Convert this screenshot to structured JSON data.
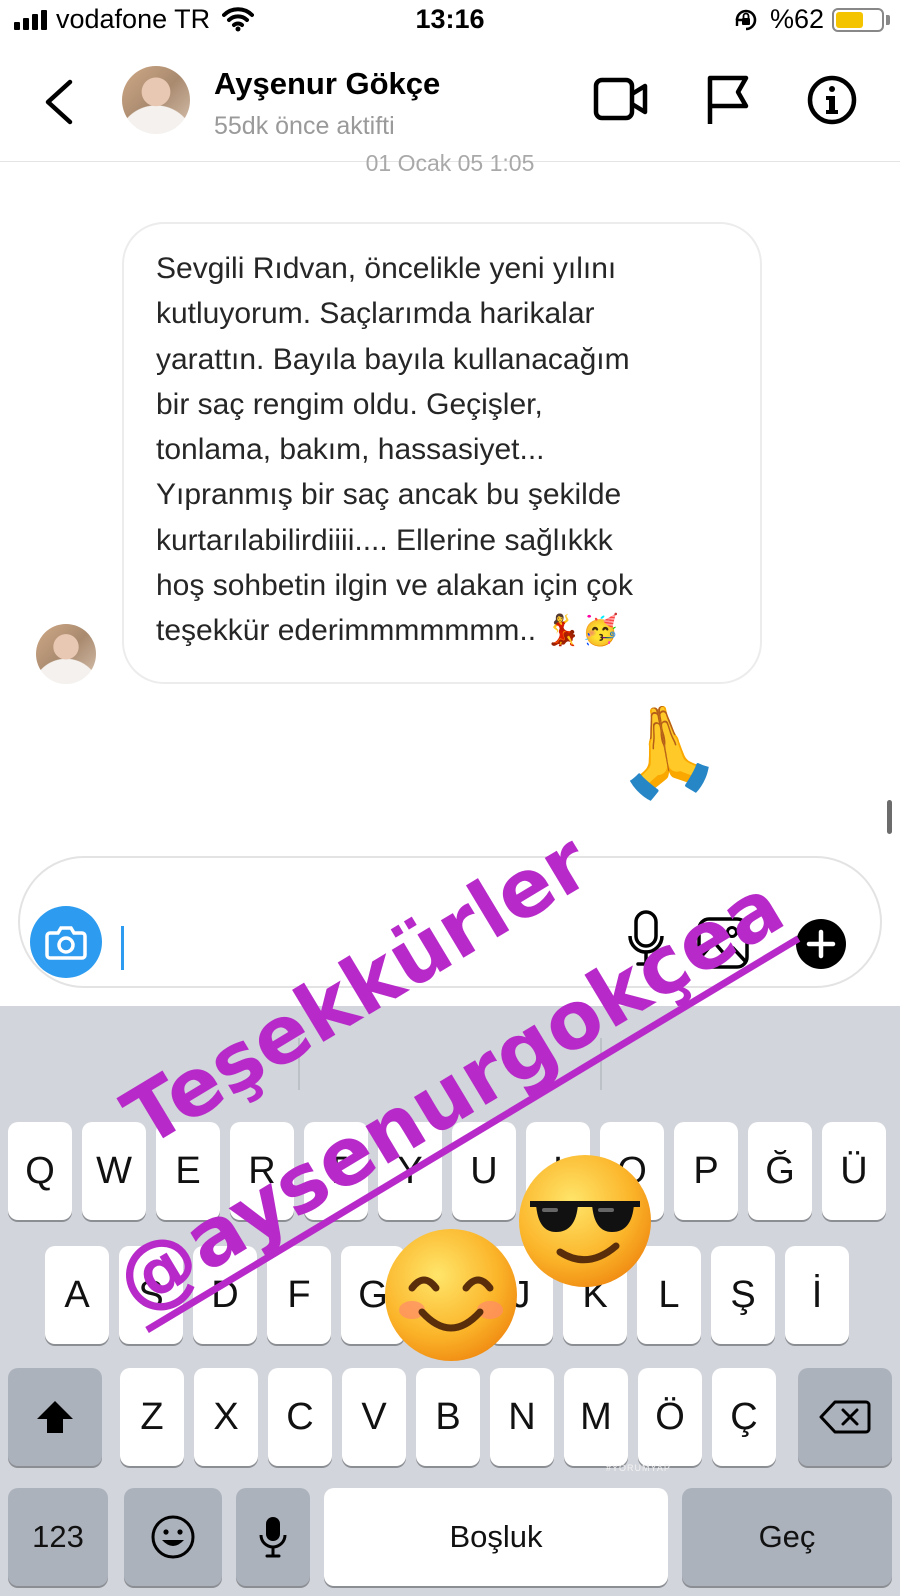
{
  "status_bar": {
    "carrier": "vodafone TR",
    "time": "13:16",
    "battery_percent": "%62",
    "battery_level": 0.62
  },
  "header": {
    "contact_name": "Ayşenur Gökçe",
    "contact_status": "55dk önce aktifti"
  },
  "chat": {
    "date_separator": "01 Ocak 05 1:05",
    "messages": [
      {
        "text": "Sevgili Rıdvan, öncelikle yeni yılını\nkutluyorum. Saçlarımda harikalar\nyarattın. Bayıla bayıla kullanacağım\nbir saç rengim oldu. Geçişler,\ntonlama, bakım, hassasiyet...\nYıpranmış bir saç ancak bu şekilde\nkurtarılabilirdiiii.... Ellerine sağlıkkk\nhoş sohbetin ilgin ve alakan için çok\nteşekkür ederimmmmmmm.. 💃🥳"
      }
    ]
  },
  "keyboard": {
    "row1": [
      "Q",
      "W",
      "E",
      "R",
      "T",
      "Y",
      "U",
      "I",
      "O",
      "P",
      "Ğ",
      "Ü"
    ],
    "row2": [
      "A",
      "S",
      "D",
      "F",
      "G",
      "H",
      "J",
      "K",
      "L",
      "Ş",
      "İ"
    ],
    "row3": [
      "Z",
      "X",
      "C",
      "V",
      "B",
      "N",
      "M",
      "Ö",
      "Ç"
    ],
    "numbers_key": "123",
    "space_key": "Boşluk",
    "return_key": "Geç"
  },
  "overlay": {
    "line1": "Teşekkürler",
    "line2": "@aysenurgokçea",
    "emoji_pray": "🙏",
    "watermark": "#YORUMYAP"
  },
  "colors": {
    "overlay_text": "#b72ac9",
    "camera_button": "#2d9cf0",
    "battery_fill": "#f5c400",
    "keyboard_bg": "#d2d5db"
  }
}
